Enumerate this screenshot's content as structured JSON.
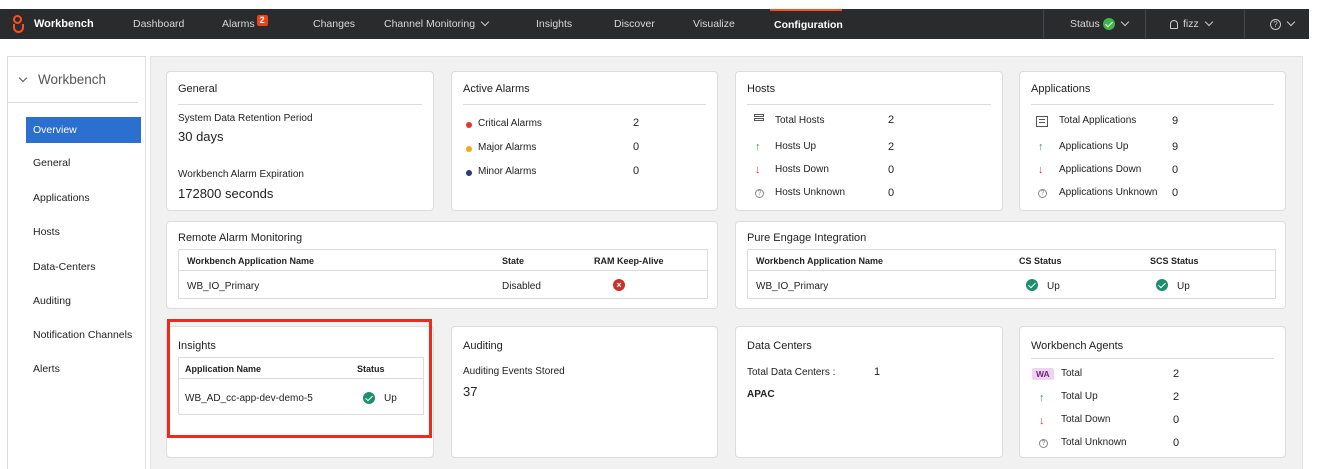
{
  "nav": {
    "brand": "Workbench",
    "items": [
      "Dashboard",
      "Alarms",
      "Changes",
      "Channel Monitoring",
      "Insights",
      "Discover",
      "Visualize",
      "Configuration"
    ],
    "alarms_badge": "2",
    "status_label": "Status",
    "user": "fizz"
  },
  "sidebar": {
    "title": "Workbench",
    "items": [
      "Overview",
      "General",
      "Applications",
      "Hosts",
      "Data-Centers",
      "Auditing",
      "Notification Channels",
      "Alerts"
    ]
  },
  "general": {
    "title": "General",
    "retention_label": "System Data Retention Period",
    "retention_value": "30 days",
    "expiration_label": "Workbench Alarm Expiration",
    "expiration_value": "172800 seconds"
  },
  "active_alarms": {
    "title": "Active Alarms",
    "rows": [
      {
        "label": "Critical Alarms",
        "value": "2",
        "color": "#e3362d"
      },
      {
        "label": "Major Alarms",
        "value": "0",
        "color": "#f0a81c"
      },
      {
        "label": "Minor Alarms",
        "value": "0",
        "color": "#2d3a7a"
      }
    ]
  },
  "hosts": {
    "title": "Hosts",
    "rows": [
      {
        "label": "Total Hosts",
        "value": "2",
        "icon": "server-icon"
      },
      {
        "label": "Hosts Up",
        "value": "2",
        "icon": "arrow-up-icon"
      },
      {
        "label": "Hosts Down",
        "value": "0",
        "icon": "arrow-down-icon"
      },
      {
        "label": "Hosts Unknown",
        "value": "0",
        "icon": "question-icon"
      }
    ]
  },
  "applications": {
    "title": "Applications",
    "rows": [
      {
        "label": "Total Applications",
        "value": "9",
        "icon": "app-window-icon"
      },
      {
        "label": "Applications Up",
        "value": "9",
        "icon": "arrow-up-icon"
      },
      {
        "label": "Applications Down",
        "value": "0",
        "icon": "arrow-down-icon"
      },
      {
        "label": "Applications Unknown",
        "value": "0",
        "icon": "question-icon"
      }
    ]
  },
  "remote_alarm": {
    "title": "Remote Alarm Monitoring",
    "headers": [
      "Workbench Application Name",
      "State",
      "RAM Keep-Alive"
    ],
    "row": {
      "name": "WB_IO_Primary",
      "state": "Disabled"
    }
  },
  "pure_engage": {
    "title": "Pure Engage Integration",
    "headers": [
      "Workbench Application Name",
      "CS Status",
      "SCS Status"
    ],
    "row": {
      "name": "WB_IO_Primary",
      "cs": "Up",
      "scs": "Up"
    }
  },
  "insights": {
    "title": "Insights",
    "headers": [
      "Application Name",
      "Status"
    ],
    "row": {
      "name": "WB_AD_cc-app-dev-demo-5",
      "status": "Up"
    }
  },
  "auditing": {
    "title": "Auditing",
    "label": "Auditing Events Stored",
    "value": "37"
  },
  "data_centers": {
    "title": "Data Centers",
    "total_label": "Total Data Centers :",
    "total_value": "1",
    "name": "APAC"
  },
  "agents": {
    "title": "Workbench Agents",
    "badge": "WA",
    "rows": [
      {
        "label": "Total",
        "value": "2"
      },
      {
        "label": "Total Up",
        "value": "2"
      },
      {
        "label": "Total Down",
        "value": "0"
      },
      {
        "label": "Total Unknown",
        "value": "0"
      }
    ]
  }
}
